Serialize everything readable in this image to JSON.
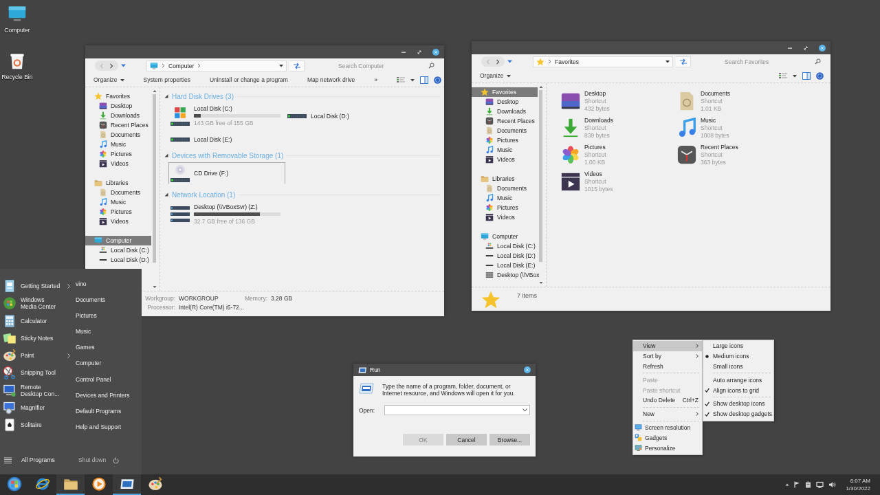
{
  "desktop_icons": [
    {
      "label": "Computer",
      "kind": "monitor"
    },
    {
      "label": "Recycle Bin",
      "kind": "bin"
    }
  ],
  "explorer_windows": [
    {
      "kind": "drives",
      "address": {
        "kind": "monitor",
        "text": "Computer"
      },
      "search_placeholder": "Search Computer",
      "toolbar": [
        {
          "label": "Organize",
          "kind": "menu"
        },
        {
          "label": "System properties",
          "kind": "button"
        },
        {
          "label": "Uninstall or change a program",
          "kind": "button"
        },
        {
          "label": "Map network drive",
          "kind": "button"
        },
        {
          "label": "»",
          "kind": "button"
        }
      ],
      "nav": [
        {
          "label": "Favorites",
          "kind": "star",
          "selected": false,
          "children": [
            {
              "label": "Desktop",
              "kind": "desktop",
              "selected": false
            },
            {
              "label": "Downloads",
              "kind": "download",
              "selected": false
            },
            {
              "label": "Recent Places",
              "kind": "clock",
              "selected": false
            },
            {
              "label": "Documents",
              "kind": "document",
              "selected": false
            },
            {
              "label": "Music",
              "kind": "music",
              "selected": false
            },
            {
              "label": "Pictures",
              "kind": "pinwheel",
              "selected": false
            },
            {
              "label": "Videos",
              "kind": "clapper",
              "selected": false
            }
          ]
        },
        {
          "label": "Libraries",
          "kind": "folder",
          "selected": false,
          "children": [
            {
              "label": "Documents",
              "kind": "document",
              "selected": false
            },
            {
              "label": "Music",
              "kind": "music",
              "selected": false
            },
            {
              "label": "Pictures",
              "kind": "pinwheel",
              "selected": false
            },
            {
              "label": "Videos",
              "kind": "clapper",
              "selected": false
            }
          ]
        },
        {
          "label": "Computer",
          "kind": "monitor",
          "selected": true,
          "children": [
            {
              "label": "Local Disk (C:)",
              "kind": "windisk",
              "selected": false
            },
            {
              "label": "Local Disk (D:)",
              "kind": "drive",
              "selected": false
            }
          ]
        }
      ],
      "sections": [
        {
          "title": "Hard Disk Drives (3)",
          "expanded": true,
          "items": [
            {
              "name": "Local Disk (C:)",
              "kind": "windows",
              "level": 0.08,
              "free": "143 GB free of 155 GB",
              "selected": false
            },
            {
              "name": "Local Disk (D:)",
              "kind": "plain",
              "selected": false
            },
            {
              "name": "Local Disk (E:)",
              "kind": "plain",
              "selected": false
            }
          ]
        },
        {
          "title": "Devices with Removable Storage (1)",
          "expanded": true,
          "items": [
            {
              "name": "CD Drive (F:)",
              "kind": "disc",
              "selected": true
            }
          ]
        },
        {
          "title": "Network Location (1)",
          "expanded": true,
          "items": [
            {
              "name": "Desktop (\\\\VBoxSvr) (Z:)",
              "kind": "network",
              "level": 0.76,
              "free": "32.7 GB free of 136 GB",
              "selected": false
            }
          ]
        }
      ],
      "details": [
        {
          "label": "Workgroup:",
          "value": "WORKGROUP"
        },
        {
          "label": "Memory:",
          "value": "3.28 GB"
        },
        {
          "label": "Processor:",
          "value": "Intel(R) Core(TM) i5-72..."
        }
      ]
    },
    {
      "kind": "files",
      "address": {
        "kind": "star",
        "text": "Favorites"
      },
      "search_placeholder": "Search Favorites",
      "toolbar": [
        {
          "label": "Organize",
          "kind": "menu"
        }
      ],
      "nav": [
        {
          "label": "Favorites",
          "kind": "star",
          "selected": true,
          "children": [
            {
              "label": "Desktop",
              "kind": "desktop",
              "selected": false
            },
            {
              "label": "Downloads",
              "kind": "download",
              "selected": false
            },
            {
              "label": "Recent Places",
              "kind": "clock",
              "selected": false
            },
            {
              "label": "Documents",
              "kind": "document",
              "selected": false
            },
            {
              "label": "Pictures",
              "kind": "pinwheel",
              "selected": false
            },
            {
              "label": "Music",
              "kind": "music",
              "selected": false
            },
            {
              "label": "Videos",
              "kind": "clapper",
              "selected": false
            }
          ]
        },
        {
          "label": "Libraries",
          "kind": "folder",
          "selected": false,
          "children": [
            {
              "label": "Documents",
              "kind": "document",
              "selected": false
            },
            {
              "label": "Music",
              "kind": "music",
              "selected": false
            },
            {
              "label": "Pictures",
              "kind": "pinwheel",
              "selected": false
            },
            {
              "label": "Videos",
              "kind": "clapper",
              "selected": false
            }
          ]
        },
        {
          "label": "Computer",
          "kind": "monitor",
          "selected": false,
          "children": [
            {
              "label": "Local Disk (C:)",
              "kind": "windisk",
              "selected": false
            },
            {
              "label": "Local Disk (D:)",
              "kind": "drive",
              "selected": false
            },
            {
              "label": "Local Disk (E:)",
              "kind": "drive",
              "selected": false
            },
            {
              "label": "Desktop (\\\\VBox",
              "kind": "netlist",
              "selected": false
            }
          ]
        }
      ],
      "items": [
        {
          "name": "Desktop",
          "type": "Shortcut",
          "size": "432 bytes",
          "kind": "desktop"
        },
        {
          "name": "Documents",
          "type": "Shortcut",
          "size": "1.01 KB",
          "kind": "document"
        },
        {
          "name": "Downloads",
          "type": "Shortcut",
          "size": "839 bytes",
          "kind": "download"
        },
        {
          "name": "Music",
          "type": "Shortcut",
          "size": "1008 bytes",
          "kind": "music"
        },
        {
          "name": "Pictures",
          "type": "Shortcut",
          "size": "1.00 KB",
          "kind": "pinwheel"
        },
        {
          "name": "Recent Places",
          "type": "Shortcut",
          "size": "363 bytes",
          "kind": "clock"
        },
        {
          "name": "Videos",
          "type": "Shortcut",
          "size": "1015 bytes",
          "kind": "clapper"
        }
      ],
      "status": {
        "kind": "star",
        "text": "7 items"
      }
    }
  ],
  "start_menu": {
    "programs": [
      {
        "label": "Getting Started",
        "kind": "getting",
        "submenu": true
      },
      {
        "label": "Windows\nMedia Center",
        "kind": "orb",
        "submenu": false
      },
      {
        "label": "Calculator",
        "kind": "calc",
        "submenu": false
      },
      {
        "label": "Sticky Notes",
        "kind": "sticky",
        "submenu": false
      },
      {
        "label": "Paint",
        "kind": "palette",
        "submenu": true
      },
      {
        "label": "Snipping Tool",
        "kind": "scissors",
        "submenu": false
      },
      {
        "label": "Remote\nDesktop Con...",
        "kind": "remote",
        "submenu": false
      },
      {
        "label": "Magnifier",
        "kind": "magnifier",
        "submenu": false
      },
      {
        "label": "Solitaire",
        "kind": "card",
        "submenu": false
      }
    ],
    "places": [
      "vino",
      "Documents",
      "Pictures",
      "Music",
      "Games",
      "Computer",
      "Control Panel",
      "Devices and Printers",
      "Default Programs",
      "Help and Support"
    ],
    "all_programs": "All Programs",
    "shutdown": "Shut down"
  },
  "run_dialog": {
    "title": "Run",
    "message": "Type the name of a program, folder, document, or Internet resource, and Windows will open it for you.",
    "open_label": "Open:",
    "buttons": [
      {
        "label": "OK",
        "disabled": true
      },
      {
        "label": "Cancel",
        "disabled": false
      },
      {
        "label": "Browse...",
        "disabled": false
      }
    ]
  },
  "context_menu": {
    "items": [
      {
        "kind": "submenu",
        "label": "View",
        "selected": true,
        "disabled": false
      },
      {
        "kind": "submenu",
        "label": "Sort by",
        "selected": false,
        "disabled": false
      },
      {
        "kind": "item",
        "label": "Refresh",
        "selected": false,
        "disabled": false
      },
      {
        "kind": "separator"
      },
      {
        "kind": "item",
        "label": "Paste",
        "selected": false,
        "disabled": true
      },
      {
        "kind": "item",
        "label": "Paste shortcut",
        "selected": false,
        "disabled": true
      },
      {
        "kind": "item",
        "label": "Undo Delete",
        "shortcut": "Ctrl+Z",
        "selected": false,
        "disabled": false
      },
      {
        "kind": "separator"
      },
      {
        "kind": "submenu",
        "label": "New",
        "selected": false,
        "disabled": false
      },
      {
        "kind": "separator"
      },
      {
        "kind": "screen",
        "label": "Screen resolution",
        "selected": false,
        "disabled": false
      },
      {
        "kind": "gadgets",
        "label": "Gadgets",
        "selected": false,
        "disabled": false
      },
      {
        "kind": "personalize",
        "label": "Personalize",
        "selected": false,
        "disabled": false
      }
    ],
    "submenu": [
      {
        "kind": "radio",
        "label": "Large icons",
        "checked": false
      },
      {
        "kind": "radio",
        "label": "Medium icons",
        "checked": true
      },
      {
        "kind": "radio",
        "label": "Small icons",
        "checked": false
      },
      {
        "kind": "separator"
      },
      {
        "kind": "check",
        "label": "Auto arrange icons",
        "checked": false
      },
      {
        "kind": "check",
        "label": "Align icons to grid",
        "checked": true
      },
      {
        "kind": "separator"
      },
      {
        "kind": "check",
        "label": "Show desktop icons",
        "checked": true
      },
      {
        "kind": "check",
        "label": "Show desktop gadgets",
        "checked": true
      }
    ]
  },
  "taskbar": {
    "apps": [
      {
        "kind": "orb_start",
        "running": false
      },
      {
        "kind": "browser",
        "running": false
      },
      {
        "kind": "folder",
        "running": true
      },
      {
        "kind": "player",
        "running": false
      },
      {
        "kind": "runwin",
        "running": true
      },
      {
        "kind": "palette",
        "running": false
      }
    ],
    "time": "6:07 AM",
    "date": "1/30/2022"
  }
}
